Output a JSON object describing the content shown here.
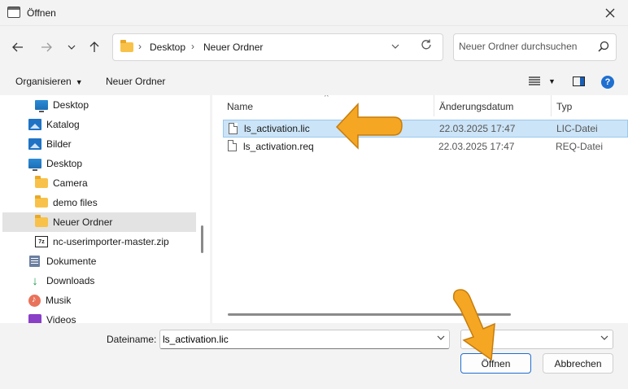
{
  "window": {
    "title": "Öffnen"
  },
  "nav": {
    "breadcrumb": [
      "Desktop",
      "Neuer Ordner"
    ],
    "search_placeholder": "Neuer Ordner durchsuchen"
  },
  "toolbar": {
    "organize_label": "Organisieren",
    "new_folder_label": "Neuer Ordner"
  },
  "sidebar": {
    "items": [
      {
        "label": "Desktop",
        "icon": "desktop-icon"
      },
      {
        "label": "Katalog",
        "icon": "picture-icon"
      },
      {
        "label": "Bilder",
        "icon": "picture-icon"
      },
      {
        "label": "Desktop",
        "icon": "desktop-icon"
      },
      {
        "label": "Camera",
        "icon": "folder-icon"
      },
      {
        "label": "demo files",
        "icon": "folder-icon"
      },
      {
        "label": "Neuer Ordner",
        "icon": "folder-icon",
        "selected": true
      },
      {
        "label": "nc-userimporter-master.zip",
        "icon": "zip-icon"
      },
      {
        "label": "Dokumente",
        "icon": "document-icon"
      },
      {
        "label": "Downloads",
        "icon": "download-icon"
      },
      {
        "label": "Musik",
        "icon": "music-icon"
      },
      {
        "label": "Videos",
        "icon": "video-icon"
      }
    ]
  },
  "filelist": {
    "columns": {
      "name": "Name",
      "date": "Änderungsdatum",
      "type": "Typ"
    },
    "rows": [
      {
        "name": "ls_activation.lic",
        "date": "22.03.2025 17:47",
        "type": "LIC-Datei",
        "selected": true
      },
      {
        "name": "ls_activation.req",
        "date": "22.03.2025 17:47",
        "type": "REQ-Datei",
        "selected": false
      }
    ]
  },
  "footer": {
    "filename_label": "Dateiname:",
    "filename_value": "ls_activation.lic",
    "open_label": "Öffnen",
    "cancel_label": "Abbrechen"
  },
  "colors": {
    "accent": "#1f6fd0",
    "selection": "#cce4f7",
    "annotation_arrow": "#f5a623"
  }
}
